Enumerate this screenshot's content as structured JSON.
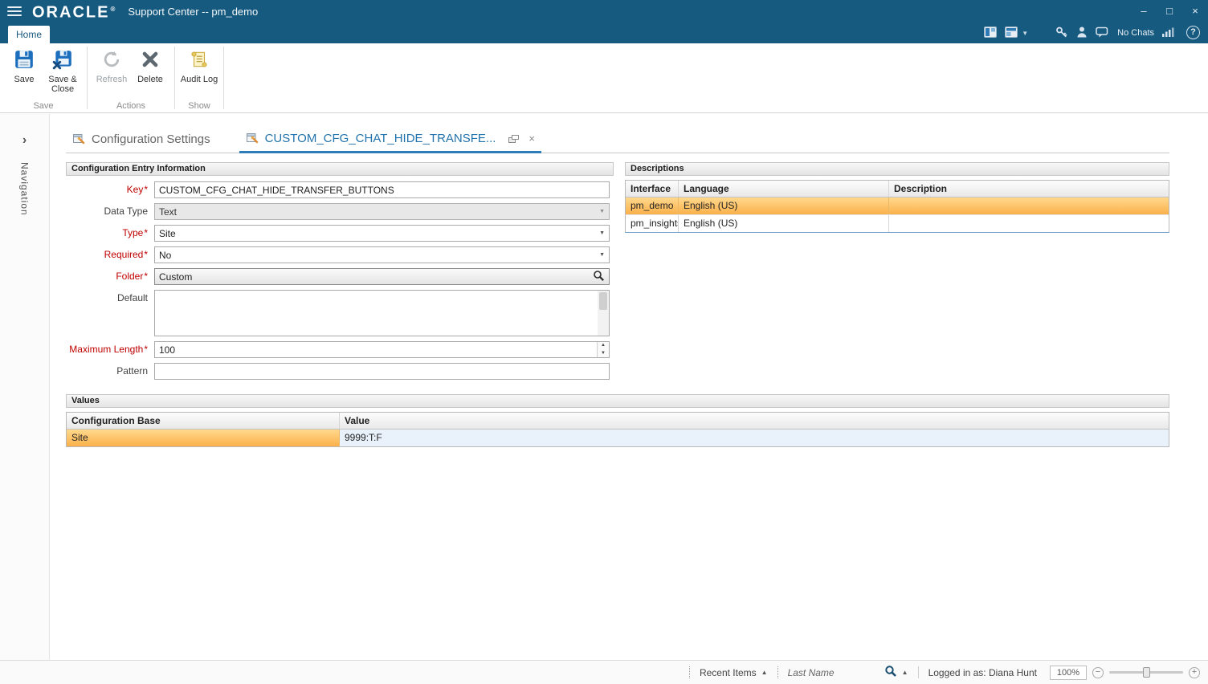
{
  "window": {
    "brand": "ORACLE",
    "registered": "®",
    "title": "Support Center -- pm_demo",
    "controls": {
      "minimize": "–",
      "maximize": "□",
      "close": "×"
    }
  },
  "ribbon": {
    "home_tab": "Home",
    "groups": [
      {
        "label": "Save"
      },
      {
        "label": "Actions"
      },
      {
        "label": "Show"
      }
    ],
    "buttons": {
      "save": "Save",
      "save_close": "Save & Close",
      "refresh": "Refresh",
      "delete": "Delete",
      "audit_log": "Audit Log"
    },
    "status_icons": {
      "no_chats": "No Chats"
    }
  },
  "nav": {
    "label": "Navigation",
    "chevron": "›"
  },
  "doc_tabs": {
    "inactive": "Configuration Settings",
    "active": "CUSTOM_CFG_CHAT_HIDE_TRANSFE...",
    "close": "×"
  },
  "entry_form": {
    "title": "Configuration Entry Information",
    "required_marker": "*",
    "fields": {
      "key": {
        "label": "Key",
        "value": "CUSTOM_CFG_CHAT_HIDE_TRANSFER_BUTTONS"
      },
      "data_type": {
        "label": "Data Type",
        "value": "Text"
      },
      "type": {
        "label": "Type",
        "value": "Site"
      },
      "required": {
        "label": "Required",
        "value": "No"
      },
      "folder": {
        "label": "Folder",
        "value": "Custom"
      },
      "default": {
        "label": "Default",
        "value": ""
      },
      "max_length": {
        "label": "Maximum Length",
        "value": "100"
      },
      "pattern": {
        "label": "Pattern",
        "value": ""
      }
    }
  },
  "descriptions": {
    "title": "Descriptions",
    "columns": [
      "Interface",
      "Language",
      "Description"
    ],
    "rows": [
      {
        "interface": "pm_demo",
        "language": "English (US)",
        "description": ""
      },
      {
        "interface": "pm_insights",
        "language": "English (US)",
        "description": ""
      }
    ]
  },
  "values": {
    "title": "Values",
    "columns": [
      "Configuration Base",
      "Value"
    ],
    "rows": [
      {
        "base": "Site",
        "value": "9999:T:F"
      }
    ]
  },
  "statusbar": {
    "recent_items": "Recent Items",
    "sort_indicator": "▲",
    "name_filter": "Last Name",
    "logged_in": "Logged in as: Diana Hunt",
    "zoom_level": "100%"
  },
  "glyphs": {
    "caret_down": "▼",
    "spin_up": "▲",
    "spin_down": "▼",
    "help": "?",
    "minus": "−",
    "plus": "+"
  }
}
